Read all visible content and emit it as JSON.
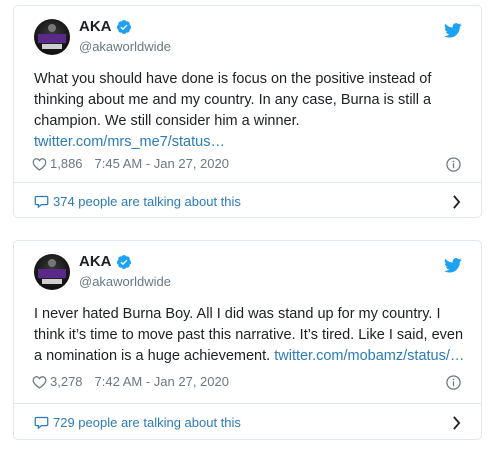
{
  "tweets": [
    {
      "display_name": "AKA",
      "handle": "@akaworldwide",
      "text": "What you should have done is focus on the positive instead of thinking about me and my country. In any case, Burna is still a champion. We still consider him a winner. ",
      "link": "twitter.com/mrs_me7/status…",
      "likes": "1,886",
      "timestamp": "7:45 AM - Jan 27, 2020",
      "talking": "374 people are talking about this"
    },
    {
      "display_name": "AKA",
      "handle": "@akaworldwide",
      "text": "I never hated Burna Boy. All I did was stand up for my country. I think it’s time to move past this narrative. It’s tired. Like I said, even a nomination is a huge achievement. ",
      "link": "twitter.com/mobamz/status/…",
      "likes": "3,278",
      "timestamp": "7:42 AM - Jan 27, 2020",
      "talking": "729 people are talking about this"
    }
  ],
  "icons": {
    "bird": "twitter-bird-icon",
    "verified": "verified-badge-icon",
    "heart": "heart-icon",
    "info": "info-icon",
    "bubble": "speech-bubble-icon",
    "chevron": "chevron-right-icon"
  },
  "colors": {
    "twitter_blue": "#1da1f2",
    "link_blue": "#2b7bb9",
    "muted": "#697882",
    "border": "#e1e8ed"
  }
}
